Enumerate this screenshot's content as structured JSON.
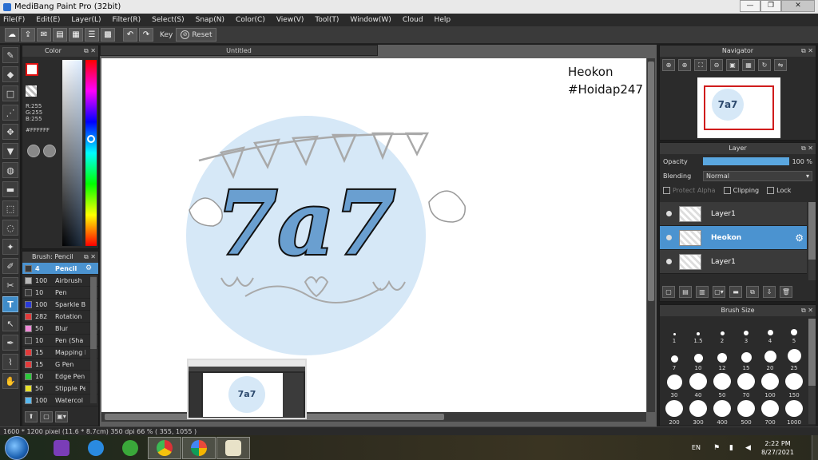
{
  "window": {
    "title": "MediBang Paint Pro (32bit)",
    "controls": [
      "—",
      "❐",
      "✕"
    ]
  },
  "menu": [
    "File(F)",
    "Edit(E)",
    "Layer(L)",
    "Filter(R)",
    "Select(S)",
    "Snap(N)",
    "Color(C)",
    "View(V)",
    "Tool(T)",
    "Window(W)",
    "Cloud",
    "Help"
  ],
  "toolbar": {
    "key_label": "Key",
    "reset_label": "Reset"
  },
  "color_panel": {
    "title": "Color",
    "r": "R:255",
    "g": "G:255",
    "b": "B:255",
    "hex": "#FFFFFF"
  },
  "brush_panel": {
    "title": "Brush: Pencil",
    "items": [
      {
        "size": "4",
        "name": "Pencil",
        "swatch": "#3a3a3a",
        "selected": true
      },
      {
        "size": "100",
        "name": "Airbrush",
        "swatch": "#b8b8b8"
      },
      {
        "size": "10",
        "name": "Pen",
        "swatch": "#3a3a3a"
      },
      {
        "size": "100",
        "name": "Sparkle B",
        "swatch": "#2a3ad8"
      },
      {
        "size": "282",
        "name": "Rotation",
        "swatch": "#e23b3b"
      },
      {
        "size": "50",
        "name": "Blur",
        "swatch": "#f08ad8"
      },
      {
        "size": "10",
        "name": "Pen (Sha",
        "swatch": "#3a3a3a"
      },
      {
        "size": "15",
        "name": "Mapping P",
        "swatch": "#e23b3b"
      },
      {
        "size": "15",
        "name": "G Pen",
        "swatch": "#e23b3b"
      },
      {
        "size": "10",
        "name": "Edge Pen",
        "swatch": "#2cc83a"
      },
      {
        "size": "50",
        "name": "Stipple Pe",
        "swatch": "#e8e02a"
      },
      {
        "size": "100",
        "name": "Watercol",
        "swatch": "#58b8ee"
      }
    ]
  },
  "canvas": {
    "tab_title": "Untitled",
    "watermark_line1": "Heokon",
    "watermark_line2": "#Hoidap247",
    "art_text": "7a7",
    "circle_color": "#d6e8f7"
  },
  "navigator": {
    "title": "Navigator"
  },
  "layer_panel": {
    "title": "Layer",
    "opacity_label": "Opacity",
    "opacity_value": "100 %",
    "opacity_fraction": 1.0,
    "blending_label": "Blending",
    "blending_value": "Normal",
    "protect_alpha": "Protect Alpha",
    "clipping": "Clipping",
    "lock": "Lock",
    "layers": [
      {
        "name": "Layer1",
        "selected": false
      },
      {
        "name": "Heokon",
        "selected": true
      },
      {
        "name": "Layer1",
        "selected": false
      }
    ]
  },
  "brush_size_panel": {
    "title": "Brush Size",
    "sizes": [
      "1",
      "1.5",
      "2",
      "3",
      "4",
      "5",
      "7",
      "10",
      "12",
      "15",
      "20",
      "25",
      "30",
      "40",
      "50",
      "70",
      "100",
      "150",
      "200",
      "300",
      "400",
      "500",
      "700",
      "1000"
    ]
  },
  "status": {
    "text": "1600 * 1200 pixel   (11.6 * 8.7cm)   350 dpi   66 %   ( 355, 1055 )"
  },
  "taskbar": {
    "language": "EN",
    "time": "2:22 PM",
    "date": "8/27/2021"
  },
  "colors": {
    "accent": "#4b93d0",
    "selected_color_fg": "#ffffff",
    "art_blue": "#6a9fd0"
  }
}
